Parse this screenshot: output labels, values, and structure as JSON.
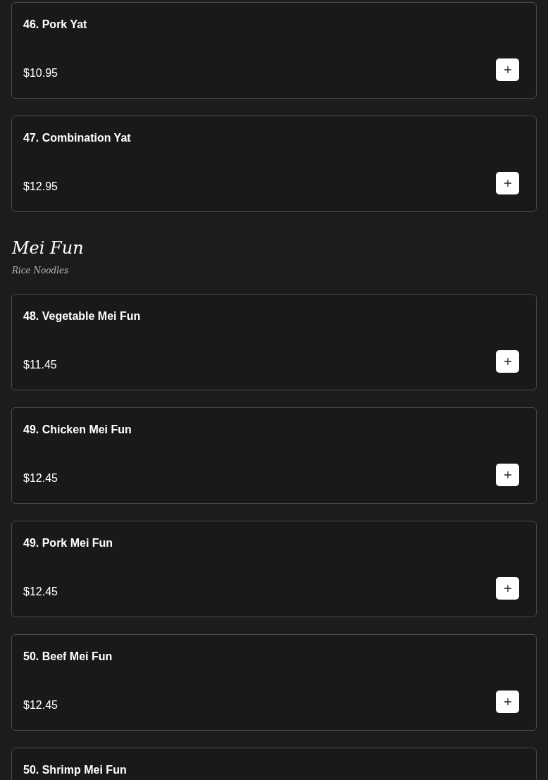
{
  "sections": [
    {
      "items": [
        {
          "name": "46. Pork Yat",
          "price": "$10.95"
        },
        {
          "name": "47. Combination Yat",
          "price": "$12.95"
        }
      ]
    },
    {
      "title": "Mei Fun",
      "subtitle": "Rice Noodles",
      "items": [
        {
          "name": "48. Vegetable Mei Fun",
          "price": "$11.45"
        },
        {
          "name": "49. Chicken Mei Fun",
          "price": "$12.45"
        },
        {
          "name": "49. Pork Mei Fun",
          "price": "$12.45"
        },
        {
          "name": "50. Beef Mei Fun",
          "price": "$12.45"
        },
        {
          "name": "50. Shrimp Mei Fun"
        }
      ]
    }
  ]
}
